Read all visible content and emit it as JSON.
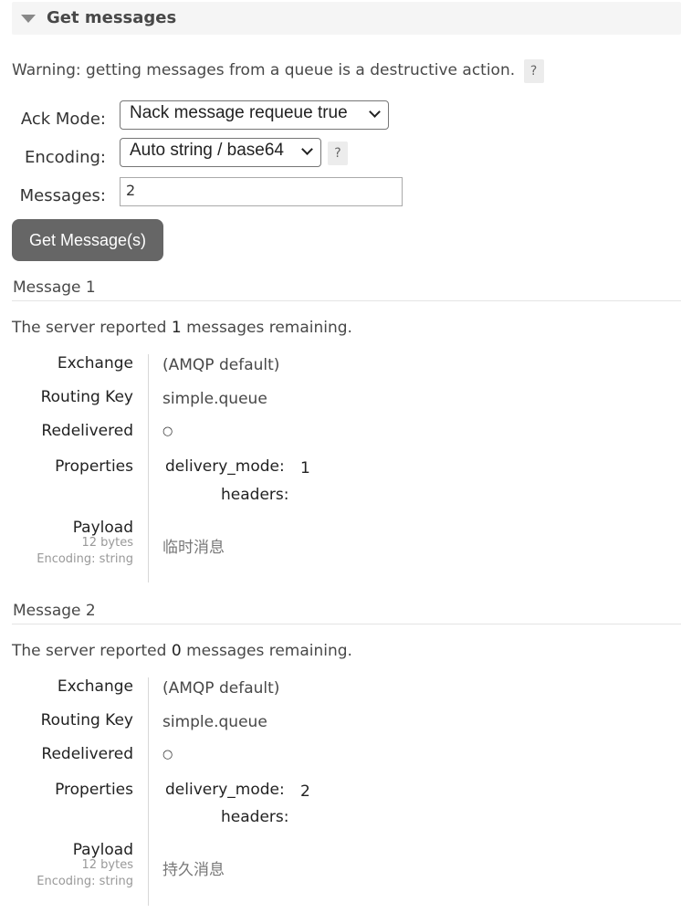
{
  "section": {
    "title": "Get messages",
    "toggle_icon": "triangle-down-icon"
  },
  "warning": {
    "text": "Warning: getting messages from a queue is a destructive action.",
    "help": "?"
  },
  "form": {
    "ack_mode": {
      "label": "Ack Mode:",
      "value": "Nack message requeue true"
    },
    "encoding": {
      "label": "Encoding:",
      "value": "Auto string / base64",
      "help": "?"
    },
    "messages": {
      "label": "Messages:",
      "value": "2"
    },
    "submit_label": "Get Message(s)"
  },
  "messages": [
    {
      "title": "Message 1",
      "remaining_prefix": "The server reported",
      "remaining_count": "1",
      "remaining_suffix": "messages remaining.",
      "exchange_label": "Exchange",
      "exchange": "(AMQP default)",
      "routing_key_label": "Routing Key",
      "routing_key": "simple.queue",
      "redelivered_label": "Redelivered",
      "redelivered": "○",
      "properties_label": "Properties",
      "delivery_mode_label": "delivery_mode:",
      "delivery_mode": "1",
      "headers_label": "headers:",
      "payload_label": "Payload",
      "payload_bytes": "12 bytes",
      "payload_encoding": "Encoding: string",
      "payload": "临时消息"
    },
    {
      "title": "Message 2",
      "remaining_prefix": "The server reported",
      "remaining_count": "0",
      "remaining_suffix": "messages remaining.",
      "exchange_label": "Exchange",
      "exchange": "(AMQP default)",
      "routing_key_label": "Routing Key",
      "routing_key": "simple.queue",
      "redelivered_label": "Redelivered",
      "redelivered": "○",
      "properties_label": "Properties",
      "delivery_mode_label": "delivery_mode:",
      "delivery_mode": "2",
      "headers_label": "headers:",
      "payload_label": "Payload",
      "payload_bytes": "12 bytes",
      "payload_encoding": "Encoding: string",
      "payload": "持久消息"
    }
  ]
}
